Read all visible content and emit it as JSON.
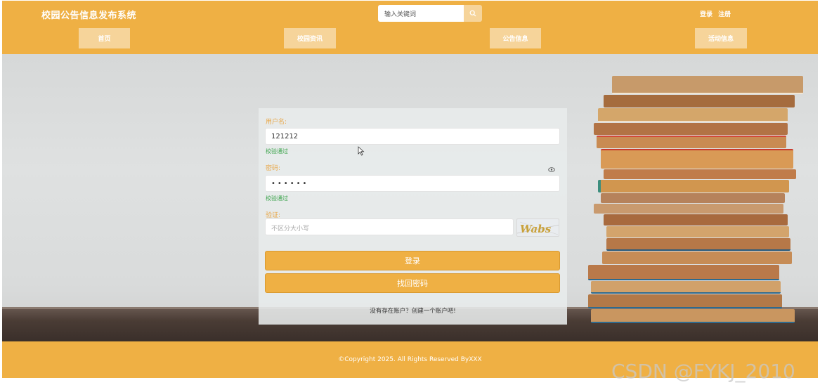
{
  "header": {
    "site_title": "校园公告信息发布系统",
    "search_placeholder": "输入关键词",
    "auth": {
      "login": "登录",
      "register": "注册"
    }
  },
  "nav": {
    "items": [
      {
        "label": "首页"
      },
      {
        "label": "校园资讯"
      },
      {
        "label": "公告信息"
      },
      {
        "label": "活动信息"
      }
    ]
  },
  "login_form": {
    "username_label": "用户名:",
    "username_value": "121212",
    "username_status": "校验通过",
    "password_label": "密码:",
    "password_value": "••••••",
    "password_status": "校验通过",
    "captcha_label": "验证:",
    "captcha_placeholder": "不区分大小写",
    "captcha_text": "Wabs",
    "login_button": "登录",
    "recover_button": "找回密码",
    "register_prompt": "没有存在账户？创建一个账户吧!"
  },
  "footer": {
    "copyright": "©Copyright 2025. All Rights Reserved ByXXX"
  },
  "watermark": "CSDN @FYKJ_2010",
  "colors": {
    "primary": "#efb044",
    "nav_button": "#f6d49a",
    "label": "#e8a84a",
    "valid": "#3aa34a"
  }
}
